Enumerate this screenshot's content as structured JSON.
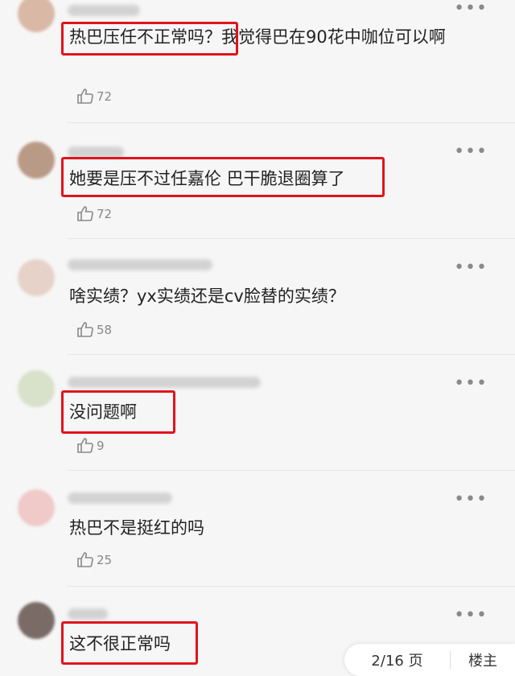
{
  "comments": [
    {
      "text": "热巴压任不正常吗？我觉得巴在90花中咖位可以啊",
      "likes": "72"
    },
    {
      "text": "她要是压不过任嘉伦 巴干脆退圈算了",
      "likes": "72"
    },
    {
      "text": "啥实绩？yx实绩还是cv脸替的实绩？",
      "likes": "58"
    },
    {
      "text": "没问题啊",
      "likes": "9"
    },
    {
      "text": "热巴不是挺红的吗",
      "likes": "25"
    },
    {
      "text": "这不很正常吗",
      "likes": ""
    }
  ],
  "more_glyph": "•••",
  "pager": {
    "page": "2/16 页",
    "owner": "楼主"
  },
  "colors": {
    "highlight": "#e1141b",
    "text": "#222222",
    "meta": "#888888"
  }
}
